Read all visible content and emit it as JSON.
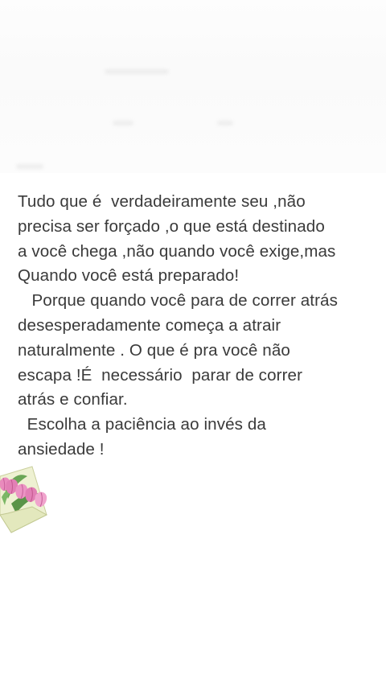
{
  "quote": {
    "lines": [
      "Tudo que é  verdadeiramente seu ,não",
      "precisa ser forçado ,o que está destinado",
      "a você chega ,não quando você exige,mas",
      "Quando você está preparado!",
      "   Porque quando você para de correr atrás",
      "desesperadamente começa a atrair",
      "naturalmente . O que é pra você não",
      "escapa !É  necessário  parar de correr",
      "atrás e confiar.",
      "  Escolha a paciência ao invés da",
      "ansiedade !"
    ]
  },
  "decoration": {
    "icon": "tulip-bouquet-envelope-icon",
    "tulip_color": "#e27fb5",
    "leaf_color": "#5f9e4e",
    "envelope_color": "#e8ecc9"
  }
}
